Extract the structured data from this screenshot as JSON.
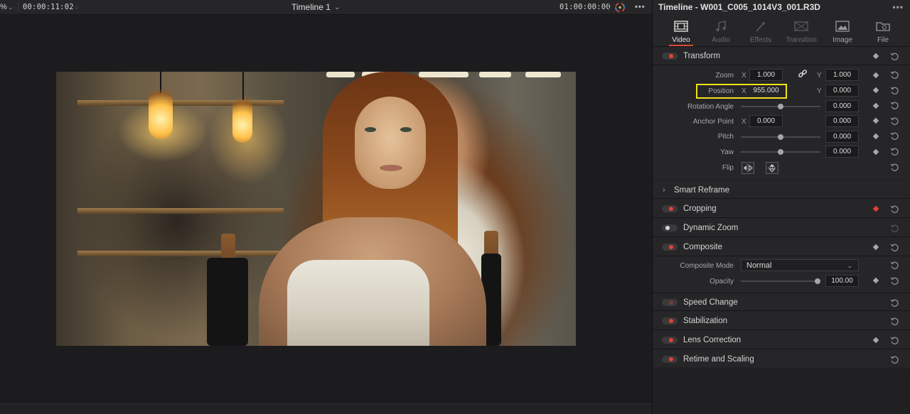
{
  "viewer": {
    "zoom_suffix": "%",
    "source_timecode": "00:00:11:02",
    "timeline_name": "Timeline 1",
    "timeline_timecode": "01:00:00:00",
    "more": "•••"
  },
  "inspector": {
    "title": "Timeline - W001_C005_1014V3_001.R3D",
    "more": "•••",
    "tabs": [
      {
        "label": "Video",
        "icon": "film-icon",
        "active": true
      },
      {
        "label": "Audio",
        "icon": "music-note-icon",
        "active": false
      },
      {
        "label": "Effects",
        "icon": "magic-wand-icon",
        "active": false
      },
      {
        "label": "Transition",
        "icon": "transition-icon",
        "active": false
      },
      {
        "label": "Image",
        "icon": "image-icon",
        "active": false
      },
      {
        "label": "File",
        "icon": "folder-icon",
        "active": false
      }
    ],
    "transform": {
      "label": "Transform",
      "zoom": {
        "label": "Zoom",
        "x_axis": "X",
        "x": "1.000",
        "y_axis": "Y",
        "y": "1.000"
      },
      "position": {
        "label": "Position",
        "x_axis": "X",
        "x": "955.000",
        "y_axis": "Y",
        "y": "0.000"
      },
      "rotation": {
        "label": "Rotation Angle",
        "value": "0.000",
        "slider": 0.5
      },
      "anchor": {
        "label": "Anchor Point",
        "x_axis": "X",
        "x": "0.000",
        "value": "0.000"
      },
      "pitch": {
        "label": "Pitch",
        "value": "0.000",
        "slider": 0.5
      },
      "yaw": {
        "label": "Yaw",
        "value": "0.000",
        "slider": 0.5
      },
      "flip": {
        "label": "Flip"
      }
    },
    "smart_reframe": {
      "label": "Smart Reframe"
    },
    "cropping": {
      "label": "Cropping"
    },
    "dynamic_zoom": {
      "label": "Dynamic Zoom"
    },
    "composite": {
      "label": "Composite",
      "mode_label": "Composite Mode",
      "mode_value": "Normal",
      "opacity_label": "Opacity",
      "opacity_value": "100.00",
      "opacity_slider": 1.0
    },
    "speed_change": {
      "label": "Speed Change"
    },
    "stabilization": {
      "label": "Stabilization"
    },
    "lens_correction": {
      "label": "Lens Correction"
    },
    "retime_scaling": {
      "label": "Retime and Scaling"
    }
  },
  "colors": {
    "accent_red": "#e8412f",
    "highlight_yellow": "#f0e11a",
    "panel_bg": "#262628",
    "viewer_bg": "#1c1c1e"
  }
}
